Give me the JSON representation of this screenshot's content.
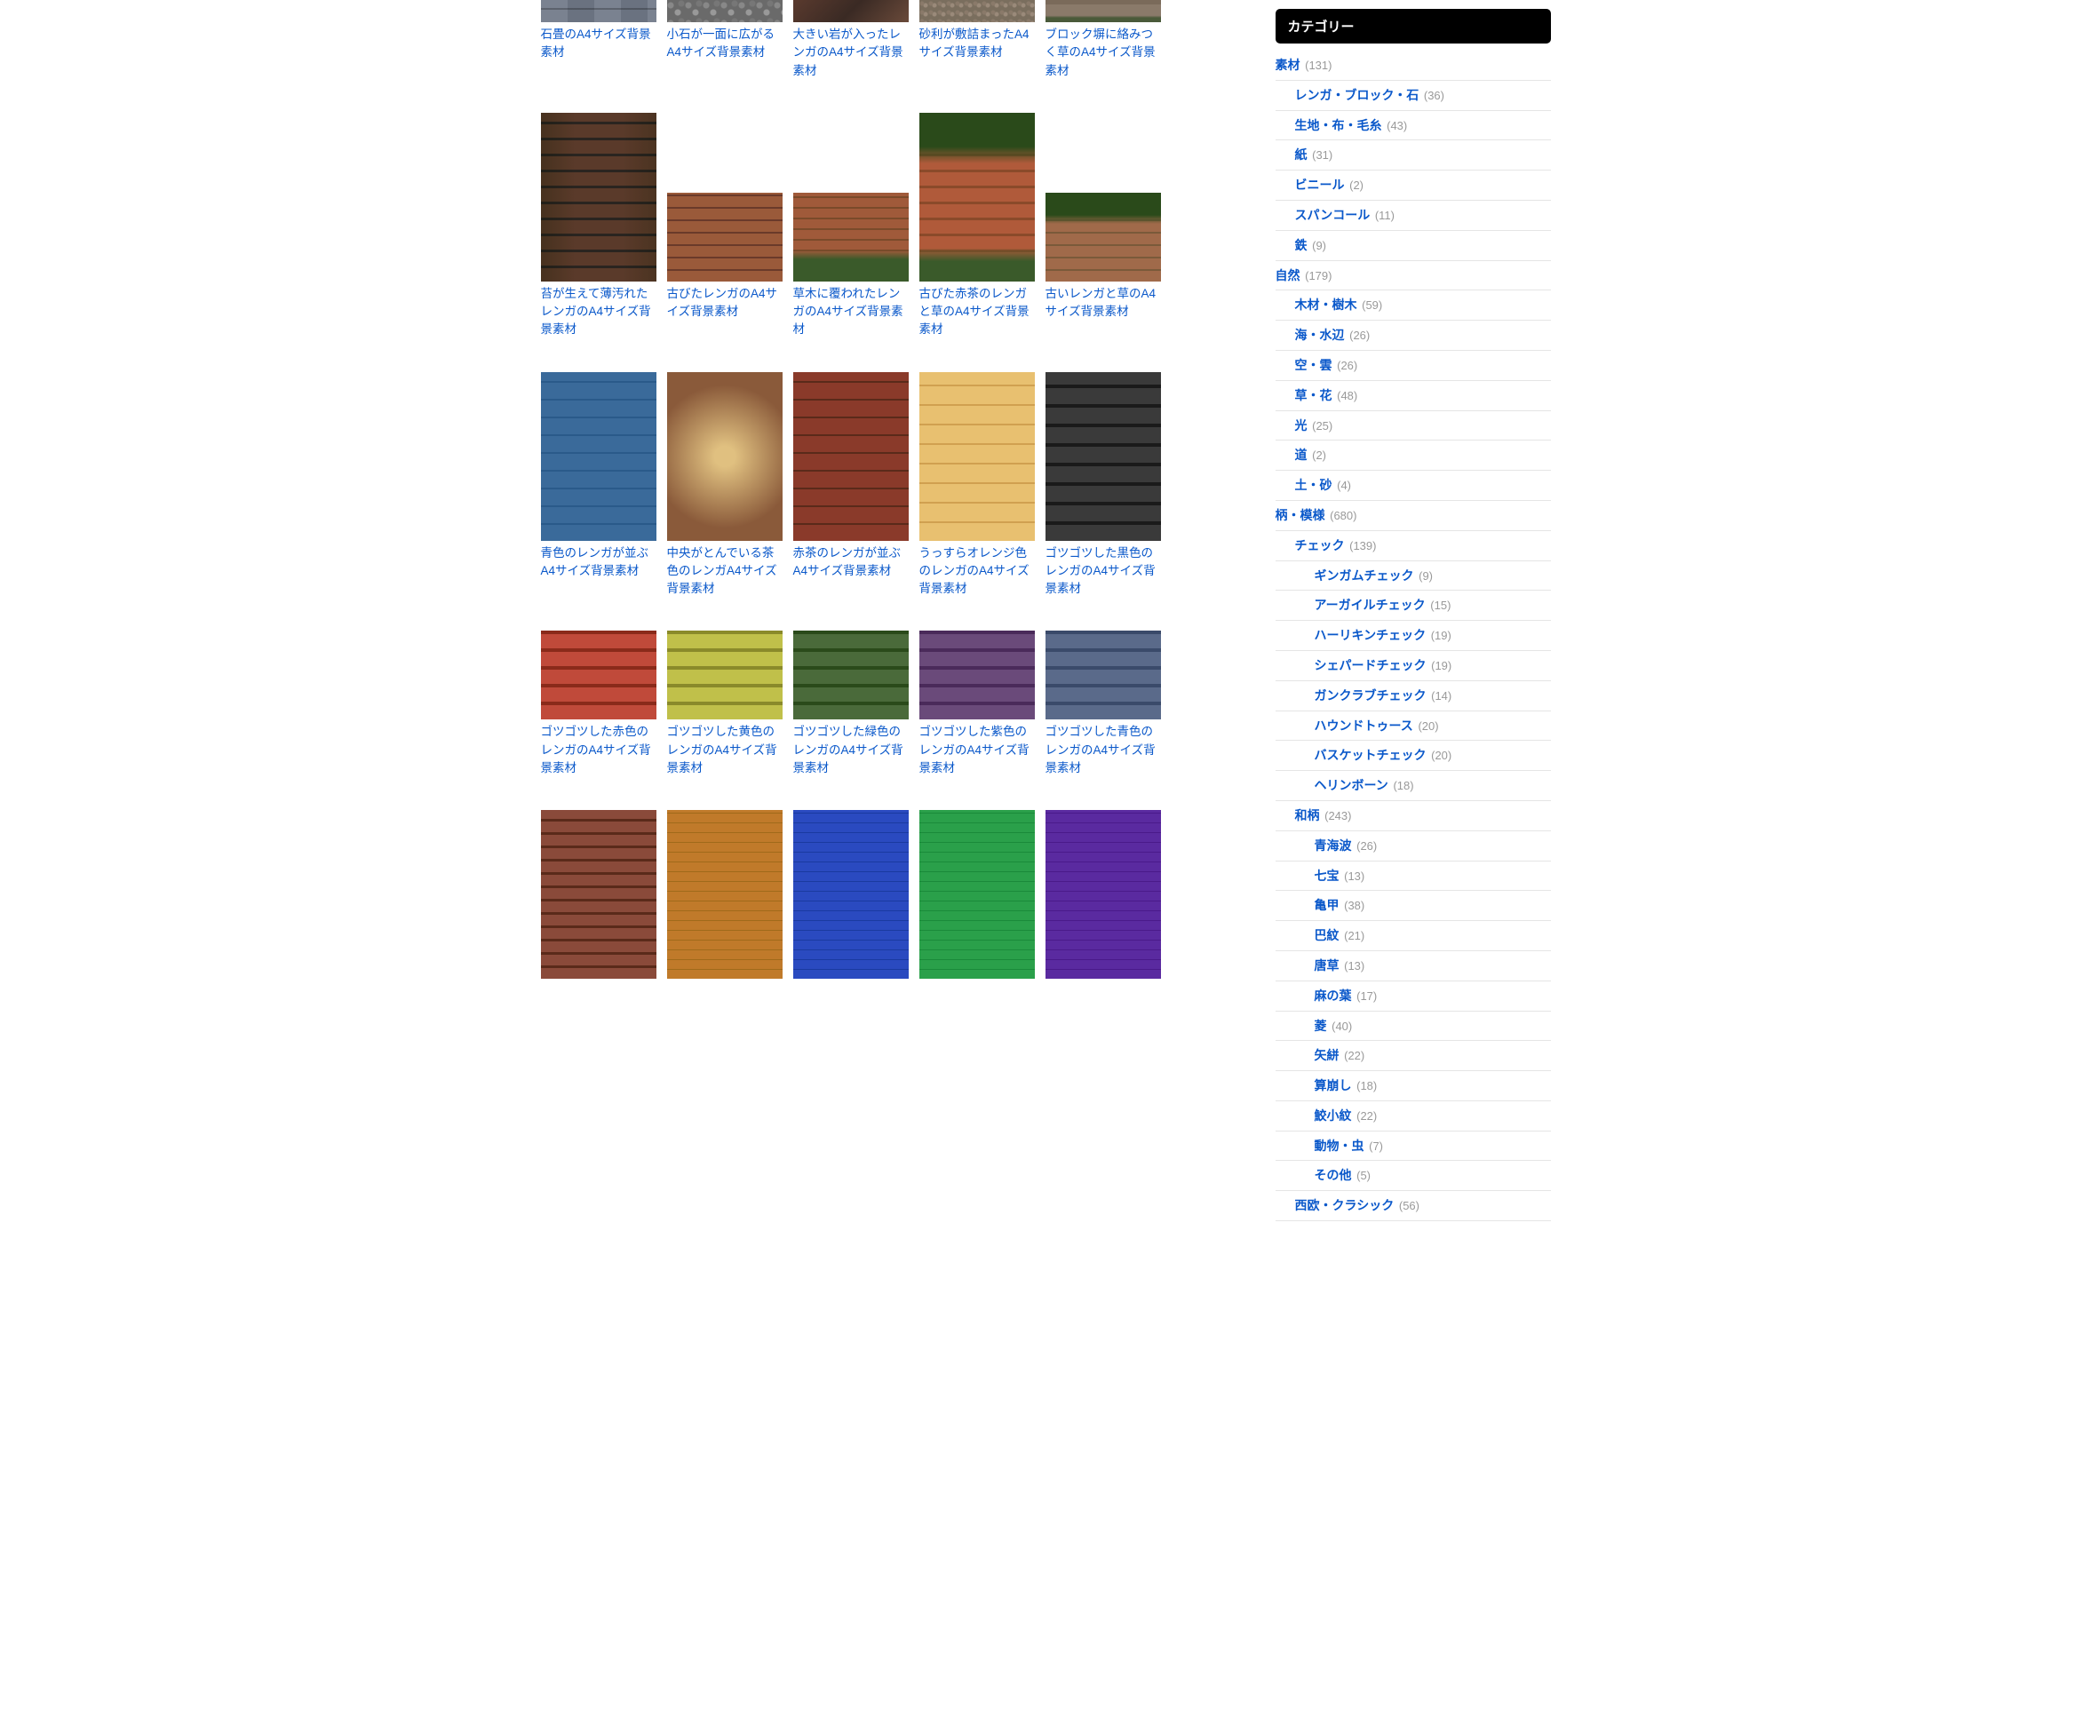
{
  "sidebar": {
    "heading": "カテゴリー",
    "categories": [
      {
        "label": "素材",
        "count": "(131)",
        "level": 1
      },
      {
        "label": "レンガ・ブロック・石",
        "count": "(36)",
        "level": 2
      },
      {
        "label": "生地・布・毛糸",
        "count": "(43)",
        "level": 2
      },
      {
        "label": "紙",
        "count": "(31)",
        "level": 2
      },
      {
        "label": "ビニール",
        "count": "(2)",
        "level": 2
      },
      {
        "label": "スパンコール",
        "count": "(11)",
        "level": 2
      },
      {
        "label": "鉄",
        "count": "(9)",
        "level": 2
      },
      {
        "label": "自然",
        "count": "(179)",
        "level": 1
      },
      {
        "label": "木材・樹木",
        "count": "(59)",
        "level": 2
      },
      {
        "label": "海・水辺",
        "count": "(26)",
        "level": 2
      },
      {
        "label": "空・雲",
        "count": "(26)",
        "level": 2
      },
      {
        "label": "草・花",
        "count": "(48)",
        "level": 2
      },
      {
        "label": "光",
        "count": "(25)",
        "level": 2
      },
      {
        "label": "道",
        "count": "(2)",
        "level": 2
      },
      {
        "label": "土・砂",
        "count": "(4)",
        "level": 2
      },
      {
        "label": "柄・模様",
        "count": "(680)",
        "level": 1
      },
      {
        "label": "チェック",
        "count": "(139)",
        "level": 2
      },
      {
        "label": "ギンガムチェック",
        "count": "(9)",
        "level": 3
      },
      {
        "label": "アーガイルチェック",
        "count": "(15)",
        "level": 3
      },
      {
        "label": "ハーリキンチェック",
        "count": "(19)",
        "level": 3
      },
      {
        "label": "シェパードチェック",
        "count": "(19)",
        "level": 3
      },
      {
        "label": "ガンクラブチェック",
        "count": "(14)",
        "level": 3
      },
      {
        "label": "ハウンドトゥース",
        "count": "(20)",
        "level": 3
      },
      {
        "label": "バスケットチェック",
        "count": "(20)",
        "level": 3
      },
      {
        "label": "ヘリンボーン",
        "count": "(18)",
        "level": 3
      },
      {
        "label": "和柄",
        "count": "(243)",
        "level": 2
      },
      {
        "label": "青海波",
        "count": "(26)",
        "level": 3
      },
      {
        "label": "七宝",
        "count": "(13)",
        "level": 3
      },
      {
        "label": "亀甲",
        "count": "(38)",
        "level": 3
      },
      {
        "label": "巴紋",
        "count": "(21)",
        "level": 3
      },
      {
        "label": "唐草",
        "count": "(13)",
        "level": 3
      },
      {
        "label": "麻の葉",
        "count": "(17)",
        "level": 3
      },
      {
        "label": "菱",
        "count": "(40)",
        "level": 3
      },
      {
        "label": "矢絣",
        "count": "(22)",
        "level": 3
      },
      {
        "label": "算崩し",
        "count": "(18)",
        "level": 3
      },
      {
        "label": "鮫小紋",
        "count": "(22)",
        "level": 3
      },
      {
        "label": "動物・虫",
        "count": "(7)",
        "level": 3
      },
      {
        "label": "その他",
        "count": "(5)",
        "level": 3
      },
      {
        "label": "西欧・クラシック",
        "count": "(56)",
        "level": 2
      }
    ]
  },
  "items": [
    {
      "title": "石畳のA4サイズ背景素材",
      "thumb": "t-stone-tile",
      "shape": "short"
    },
    {
      "title": "小石が一面に広がるA4サイズ背景素材",
      "thumb": "t-pebbles",
      "shape": "short"
    },
    {
      "title": "大きい岩が入ったレンガのA4サイズ背景素材",
      "thumb": "t-bigrock",
      "shape": "short"
    },
    {
      "title": "砂利が敷詰まったA4サイズ背景素材",
      "thumb": "t-gravel",
      "shape": "short"
    },
    {
      "title": "ブロック塀に絡みつく草のA4サイズ背景素材",
      "thumb": "t-block-grass",
      "shape": "short"
    },
    {
      "title": "苔が生えて薄汚れたレンガのA4サイズ背景素材",
      "thumb": "t-brick-moss",
      "shape": "tall"
    },
    {
      "title": "古びたレンガのA4サイズ背景素材",
      "thumb": "t-brick-old",
      "shape": "wide"
    },
    {
      "title": "草木に覆われたレンガのA4サイズ背景素材",
      "thumb": "t-brick-tree",
      "shape": "wide"
    },
    {
      "title": "古びた赤茶のレンガと草のA4サイズ背景素材",
      "thumb": "t-brick-redgrass",
      "shape": "tall"
    },
    {
      "title": "古いレンガと草のA4サイズ背景素材",
      "thumb": "t-brick-oldgrass",
      "shape": "wide"
    },
    {
      "title": "青色のレンガが並ぶA4サイズ背景素材",
      "thumb": "t-brick-blue",
      "shape": "tall"
    },
    {
      "title": "中央がとんでいる茶色のレンガA4サイズ背景素材",
      "thumb": "t-brick-brown-center",
      "shape": "tall"
    },
    {
      "title": "赤茶のレンガが並ぶA4サイズ背景素材",
      "thumb": "t-brick-red",
      "shape": "tall"
    },
    {
      "title": "うっすらオレンジ色のレンガのA4サイズ背景素材",
      "thumb": "t-brick-orange",
      "shape": "tall"
    },
    {
      "title": "ゴツゴツした黒色のレンガのA4サイズ背景素材",
      "thumb": "t-brick-black",
      "shape": "tall"
    },
    {
      "title": "ゴツゴツした赤色のレンガのA4サイズ背景素材",
      "thumb": "t-brick-red-rough",
      "shape": "wide"
    },
    {
      "title": "ゴツゴツした黄色のレンガのA4サイズ背景素材",
      "thumb": "t-brick-yellow",
      "shape": "wide"
    },
    {
      "title": "ゴツゴツした緑色のレンガのA4サイズ背景素材",
      "thumb": "t-brick-green",
      "shape": "wide"
    },
    {
      "title": "ゴツゴツした紫色のレンガのA4サイズ背景素材",
      "thumb": "t-brick-purple",
      "shape": "wide"
    },
    {
      "title": "ゴツゴツした青色のレンガのA4サイズ背景素材",
      "thumb": "t-brick-blue-rough",
      "shape": "wide"
    },
    {
      "title": "",
      "thumb": "t-brick-small",
      "shape": "tall"
    },
    {
      "title": "",
      "thumb": "t-tile-orange",
      "shape": "tall"
    },
    {
      "title": "",
      "thumb": "t-tile-blue",
      "shape": "tall"
    },
    {
      "title": "",
      "thumb": "t-tile-green",
      "shape": "tall"
    },
    {
      "title": "",
      "thumb": "t-tile-purple",
      "shape": "tall"
    }
  ]
}
